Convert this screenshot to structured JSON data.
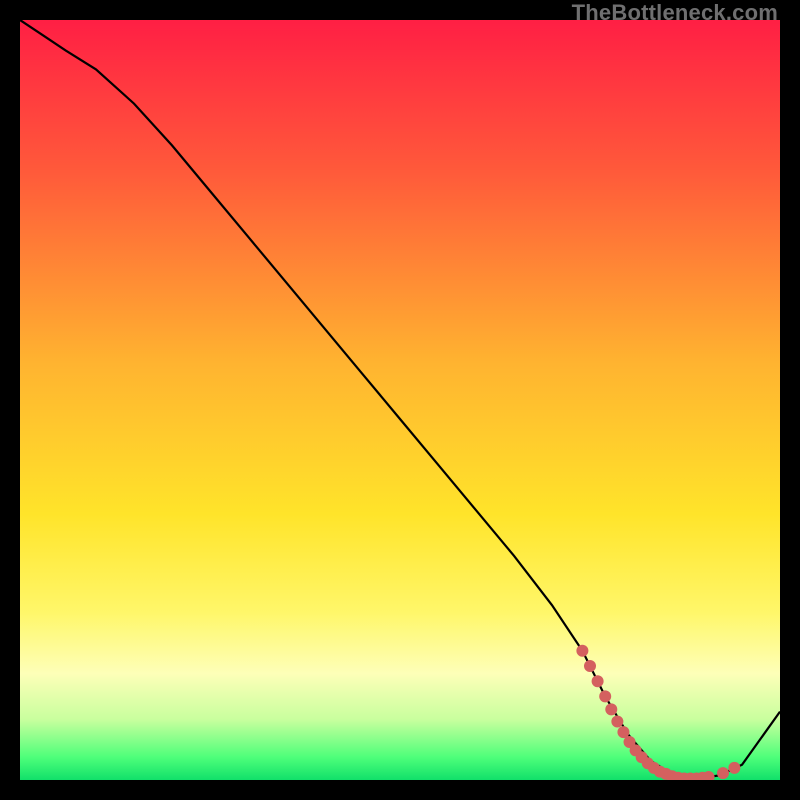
{
  "watermark": "TheBottleneck.com",
  "chart_data": {
    "type": "line",
    "title": "",
    "xlabel": "",
    "ylabel": "",
    "xlim": [
      0,
      100
    ],
    "ylim": [
      0,
      100
    ],
    "grid": false,
    "legend": false,
    "gradient_stops": [
      {
        "offset": 0,
        "color": "#ff1f44"
      },
      {
        "offset": 20,
        "color": "#ff5a3a"
      },
      {
        "offset": 45,
        "color": "#ffb330"
      },
      {
        "offset": 65,
        "color": "#ffe42a"
      },
      {
        "offset": 78,
        "color": "#fff76a"
      },
      {
        "offset": 86,
        "color": "#fdffb8"
      },
      {
        "offset": 92,
        "color": "#c9ff9e"
      },
      {
        "offset": 97,
        "color": "#4eff7a"
      },
      {
        "offset": 100,
        "color": "#11e06a"
      }
    ],
    "series": [
      {
        "name": "curve",
        "color": "#000000",
        "x": [
          0,
          3,
          6,
          10,
          15,
          20,
          25,
          30,
          35,
          40,
          45,
          50,
          55,
          60,
          65,
          70,
          74,
          77,
          80,
          83,
          86,
          89,
          92,
          95,
          100
        ],
        "y": [
          100,
          98,
          96,
          93.5,
          89,
          83.5,
          77.5,
          71.5,
          65.5,
          59.5,
          53.5,
          47.5,
          41.5,
          35.5,
          29.5,
          23,
          17,
          11,
          6,
          2.5,
          0.7,
          0.2,
          0.6,
          2,
          9
        ]
      }
    ],
    "markers": {
      "color": "#d4605f",
      "radius": 6,
      "points": [
        {
          "x": 74.0,
          "y": 17.0
        },
        {
          "x": 75.0,
          "y": 15.0
        },
        {
          "x": 76.0,
          "y": 13.0
        },
        {
          "x": 77.0,
          "y": 11.0
        },
        {
          "x": 77.8,
          "y": 9.3
        },
        {
          "x": 78.6,
          "y": 7.7
        },
        {
          "x": 79.4,
          "y": 6.3
        },
        {
          "x": 80.2,
          "y": 5.0
        },
        {
          "x": 81.0,
          "y": 3.9
        },
        {
          "x": 81.8,
          "y": 3.0
        },
        {
          "x": 82.6,
          "y": 2.2
        },
        {
          "x": 83.4,
          "y": 1.6
        },
        {
          "x": 84.2,
          "y": 1.1
        },
        {
          "x": 85.0,
          "y": 0.8
        },
        {
          "x": 85.8,
          "y": 0.5
        },
        {
          "x": 86.6,
          "y": 0.3
        },
        {
          "x": 87.4,
          "y": 0.2
        },
        {
          "x": 88.2,
          "y": 0.2
        },
        {
          "x": 89.0,
          "y": 0.2
        },
        {
          "x": 89.8,
          "y": 0.3
        },
        {
          "x": 90.6,
          "y": 0.4
        },
        {
          "x": 92.5,
          "y": 0.9
        },
        {
          "x": 94.0,
          "y": 1.6
        }
      ]
    }
  }
}
